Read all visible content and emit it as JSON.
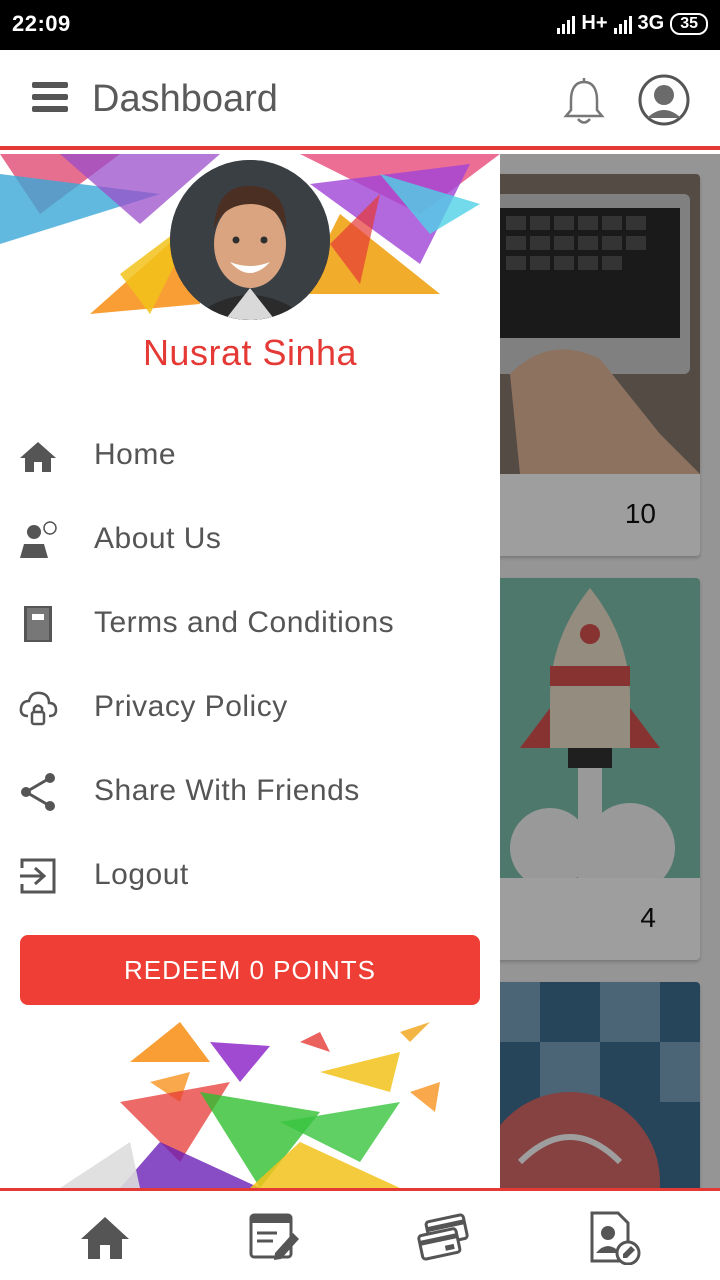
{
  "status_bar": {
    "time": "22:09",
    "network1": "H+",
    "network2": "3G",
    "battery": "35"
  },
  "header": {
    "title": "Dashboard",
    "menu_icon": "hamburger-menu-icon",
    "notification_icon": "bell-icon",
    "profile_icon": "user-avatar-icon"
  },
  "drawer": {
    "user_name": "Nusrat Sinha",
    "menu": [
      {
        "label": "Home",
        "icon": "home-icon"
      },
      {
        "label": "About Us",
        "icon": "about-icon"
      },
      {
        "label": "Terms and Conditions",
        "icon": "book-icon"
      },
      {
        "label": "Privacy Policy",
        "icon": "cloud-lock-icon"
      },
      {
        "label": "Share With Friends",
        "icon": "share-icon"
      },
      {
        "label": "Logout",
        "icon": "logout-icon"
      }
    ],
    "redeem_label": "REDEEM 0 POINTS"
  },
  "content": {
    "cards": [
      {
        "count": "10"
      },
      {
        "count": "4"
      },
      {
        "count": ""
      }
    ]
  },
  "bottom_nav": [
    {
      "icon": "home-icon"
    },
    {
      "icon": "edit-note-icon"
    },
    {
      "icon": "cards-icon"
    },
    {
      "icon": "profile-edit-icon"
    }
  ],
  "colors": {
    "accent": "#e53935",
    "redeem": "#ef3e36",
    "icon": "#555555"
  }
}
